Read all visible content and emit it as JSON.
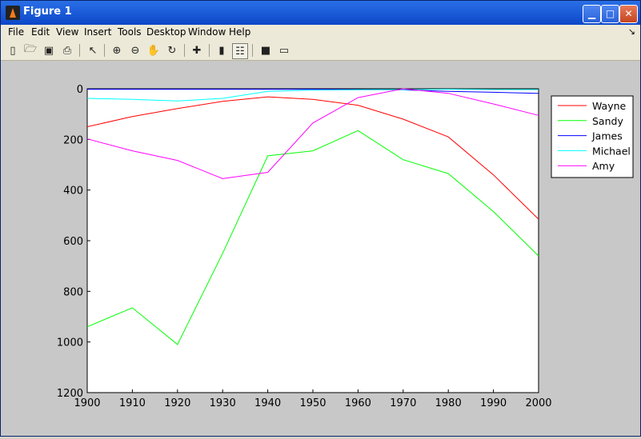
{
  "window": {
    "title": "Figure 1"
  },
  "menu": [
    "File",
    "Edit",
    "View",
    "Insert",
    "Tools",
    "Desktop",
    "Window",
    "Help"
  ],
  "toolbar": {
    "icons": [
      "new-file-icon",
      "open-folder-icon",
      "save-icon",
      "print-icon",
      "pointer-arrow-icon",
      "zoom-in-icon",
      "zoom-out-icon",
      "pan-hand-icon",
      "rotate-3d-icon",
      "data-cursor-icon",
      "insert-colorbar-icon",
      "insert-legend-icon",
      "hide-plot-tools-icon",
      "show-plot-tools-icon"
    ]
  },
  "chart_data": {
    "type": "line",
    "x": [
      1900,
      1910,
      1920,
      1930,
      1940,
      1950,
      1960,
      1970,
      1980,
      1990,
      2000
    ],
    "xlim": [
      1900,
      2000
    ],
    "ylim": [
      0,
      1200
    ],
    "y_reversed": true,
    "xticks": [
      "1900",
      "1910",
      "1920",
      "1930",
      "1940",
      "1950",
      "1960",
      "1970",
      "1980",
      "1990",
      "2000"
    ],
    "yticks": [
      "0",
      "200",
      "400",
      "600",
      "800",
      "1000",
      "1200"
    ],
    "legend_position": "right",
    "series": [
      {
        "name": "Wayne",
        "color": "#ff0000",
        "values": [
          150,
          110,
          78,
          50,
          32,
          42,
          65,
          120,
          190,
          340,
          515
        ]
      },
      {
        "name": "Sandy",
        "color": "#00ff00",
        "values": [
          940,
          865,
          1010,
          650,
          265,
          245,
          165,
          280,
          335,
          485,
          660
        ]
      },
      {
        "name": "James",
        "color": "#0000ff",
        "values": [
          2,
          2,
          2,
          2,
          2,
          2,
          3,
          4,
          10,
          14,
          18
        ]
      },
      {
        "name": "Michael",
        "color": "#00ffff",
        "values": [
          38,
          42,
          48,
          38,
          10,
          5,
          4,
          3,
          2,
          3,
          3
        ]
      },
      {
        "name": "Amy",
        "color": "#ff00ff",
        "values": [
          198,
          245,
          283,
          355,
          330,
          135,
          35,
          0,
          18,
          60,
          105
        ]
      }
    ]
  }
}
